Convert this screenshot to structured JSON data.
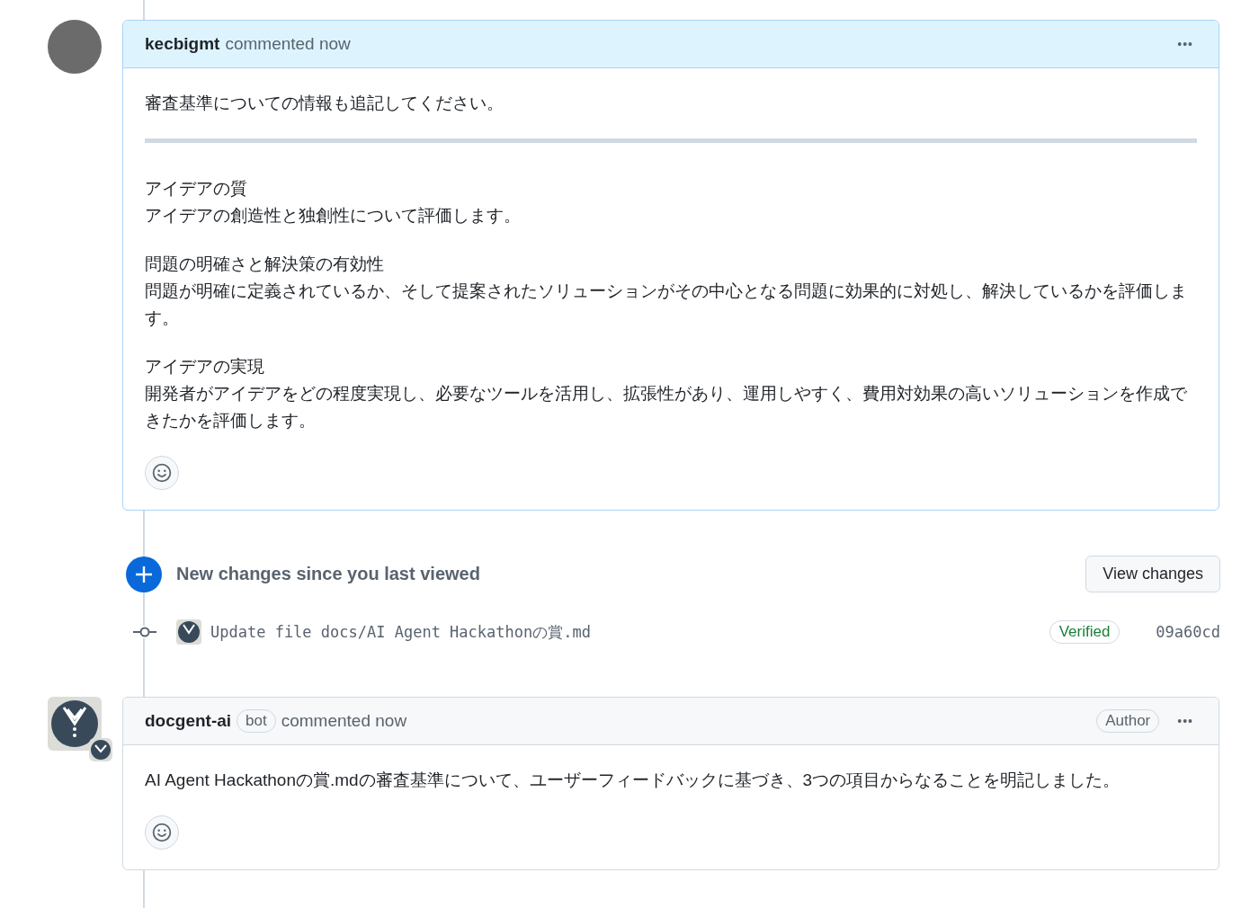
{
  "timeline": [
    {
      "kind": "comment",
      "highlighted": true,
      "avatar": {
        "kind": "photo"
      },
      "author": "kecbigmt",
      "action": "commented now",
      "more": "•••",
      "body": [
        {
          "kind": "paragraph",
          "text": "審査基準についての情報も追記してください。"
        },
        {
          "kind": "rule"
        },
        {
          "kind": "section",
          "title": "アイデアの質",
          "text": "アイデアの創造性と独創性について評価します。"
        },
        {
          "kind": "section",
          "title": "問題の明確さと解決策の有効性",
          "text": "問題が明確に定義されているか、そして提案されたソリューションがその中心となる問題に効果的に対処し、解決しているかを評価します。"
        },
        {
          "kind": "section",
          "title": "アイデアの実現",
          "text": "開発者がアイデアをどの程度実現し、必要なツールを活用し、拡張性があり、運用しやすく、費用対効果の高いソリューションを作成できたかを評価します。"
        }
      ]
    },
    {
      "kind": "new-changes",
      "text": "New changes since you last viewed",
      "button": "View changes"
    },
    {
      "kind": "commit",
      "message": "Update file docs/AI Agent Hackathonの賞.md",
      "verified": "Verified",
      "sha": "09a60cd"
    },
    {
      "kind": "comment",
      "highlighted": false,
      "avatar": {
        "kind": "bot"
      },
      "author": "docgent-ai",
      "bot_label": "bot",
      "action": "commented now",
      "author_badge": "Author",
      "more": "•••",
      "body": [
        {
          "kind": "paragraph",
          "text": "AI Agent Hackathonの賞.mdの審査基準について、ユーザーフィードバックに基づき、3つの項目からなることを明記しました。"
        }
      ]
    }
  ]
}
